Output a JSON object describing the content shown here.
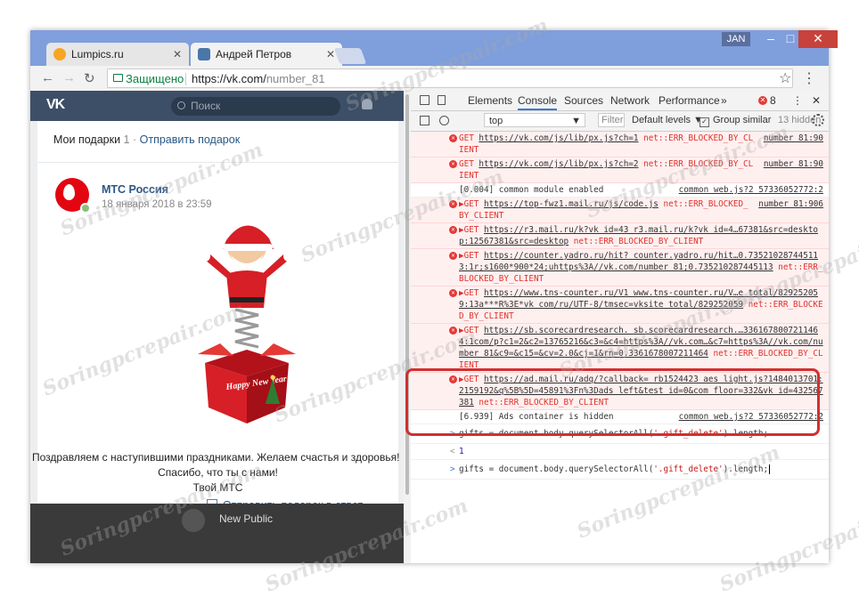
{
  "window": {
    "tabs": [
      {
        "title": "Lumpics.ru",
        "active": false
      },
      {
        "title": "Андрей Петров",
        "active": true
      }
    ],
    "user_badge": "JAN",
    "controls": {
      "minimize": "–",
      "maximize": "□",
      "close": "✕"
    }
  },
  "address_bar": {
    "secure_label": "Защищено",
    "url_main": "https://vk.com/",
    "url_rest": "number_81"
  },
  "vk": {
    "search_placeholder": "Поиск",
    "gifts_header": "Мои подарки",
    "gifts_count": "1",
    "send_gift": "Отправить подарок",
    "sender_name": "МТС Россия",
    "sender_date": "18 января 2018 в 23:59",
    "gift_text": "Happy New Year!",
    "congrats_line1": "Поздравляем с наступившими праздниками. Желаем счастья и здоровья!",
    "congrats_line2": "Спасибо, что ты с нами!",
    "congrats_line3": "Твой МТС",
    "reply_link": "Отправить подарок в ответ",
    "bottom_item": "New Public"
  },
  "devtools": {
    "tabs": [
      "Elements",
      "Console",
      "Sources",
      "Network",
      "Performance"
    ],
    "more": "»",
    "error_count": "8",
    "context": "top",
    "filter_placeholder": "Filter",
    "levels": "Default levels ▼",
    "group_similar": "Group similar",
    "hidden_count": "13 hidden",
    "console": [
      {
        "type": "error",
        "text": "GET ",
        "link": "https://vk.com/js/lib/px.js?ch=1",
        "msg": " net::ERR_BLOCKED_BY_CLIENT",
        "src": "number 81:90"
      },
      {
        "type": "error",
        "text": "GET ",
        "link": "https://vk.com/js/lib/px.js?ch=2",
        "msg": " net::ERR_BLOCKED_BY_CLIENT",
        "src": "number 81:90"
      },
      {
        "type": "info",
        "text": "[0.004]  common module enabled",
        "link": "",
        "msg": "",
        "src": "common web.js?2 57336052772:2"
      },
      {
        "type": "error",
        "text": "▶GET ",
        "link": "https://top-fwz1.mail.ru/js/code.js",
        "msg": " net::ERR_BLOCKED_BY_CLIENT",
        "src": "number 81:906"
      },
      {
        "type": "error",
        "text": "▶GET ",
        "link": "https://r3.mail.ru/k?vk id=43  r3.mail.ru/k?vk id=4…67381&src=desktop:12567381&src=desktop",
        "msg": " net::ERR_BLOCKED_BY_CLIENT",
        "src": ""
      },
      {
        "type": "error",
        "text": "▶GET ",
        "link": "https://counter.yadro.ru/hit?  counter.yadro.ru/hit…0.735210287445113:1r;s1600*900*24;uhttps%3A//vk.com/number 81;0.735210287445113",
        "msg": " net::ERR_BLOCKED_BY_CLIENT",
        "src": ""
      },
      {
        "type": "error",
        "text": "▶GET ",
        "link": "https://www.tns-counter.ru/V1  www.tns-counter.ru/V…e total/829252059:13a***R%3E*vk com/ru/UTF-8/tmsec=vksite total/829252059",
        "msg": " net::ERR_BLOCKED_BY_CLIENT",
        "src": ""
      },
      {
        "type": "error",
        "text": "▶GET ",
        "link": "https://sb.scorecardresearch.  sb.scorecardresearch.…3361678007211464:1com/p?c1=2&c2=13765216&c3=&c4=https%3A//vk.com…&c7=https%3A//vk.com/number 81&c9=&c15=&cv=2.0&cj=1&rn=0.3361678007211464",
        "msg": " net::ERR_BLOCKED_BY_CLIENT",
        "src": ""
      },
      {
        "type": "error",
        "text": "▶GET ",
        "link": "https://ad.mail.ru/adq/?callback=  rb1524423  aes light.js?1484013701:2159192&q%5B%5D=45891%3Fn%3Dads left&test id=0&com floor=332&vk id=432567381",
        "msg": " net::ERR_BLOCKED_BY_CLIENT",
        "src": ""
      },
      {
        "type": "info",
        "text": "[6.939]  Ads container is hidden",
        "link": "",
        "msg": "",
        "src": "common web.js?2 57336052772:2"
      }
    ],
    "input_1_pre": "gifts = document.body.querySelectorAll(",
    "input_1_str": "'.gift_delete'",
    "input_1_post": ").length;",
    "result_1": "1",
    "input_2_pre": "gifts = document.body.querySelectorAll(",
    "input_2_str": "'.gift_delete'",
    "input_2_post": ").length;"
  },
  "watermark": "Soringpcrepair.com",
  "colors": {
    "accent_red": "#d32f2f",
    "vk_blue": "#2a5885",
    "console_error": "#e0312a"
  }
}
